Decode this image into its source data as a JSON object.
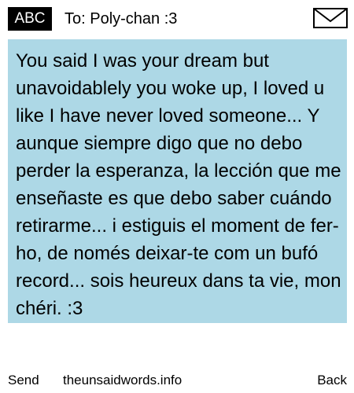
{
  "header": {
    "mode_label": "ABC",
    "recipient": "To: Poly-chan :3",
    "envelope_icon": "envelope-icon"
  },
  "message": {
    "body": "You said I was your dream but unavoidablely you woke up, I loved u like I have never loved someone... Y aunque siempre digo que no debo perder la esperanza, la lección que me enseñaste es que debo saber cuándo retirarme... i estiguis el moment de fer-ho, de només deixar-te com un bufó record... sois heureux dans ta vie, mon chéri. :3"
  },
  "softkeys": {
    "left": "Send",
    "center": "theunsaidwords.info",
    "right": "Back"
  },
  "colors": {
    "message_background": "#add8e6",
    "badge_background": "#000000",
    "badge_text": "#ffffff"
  }
}
